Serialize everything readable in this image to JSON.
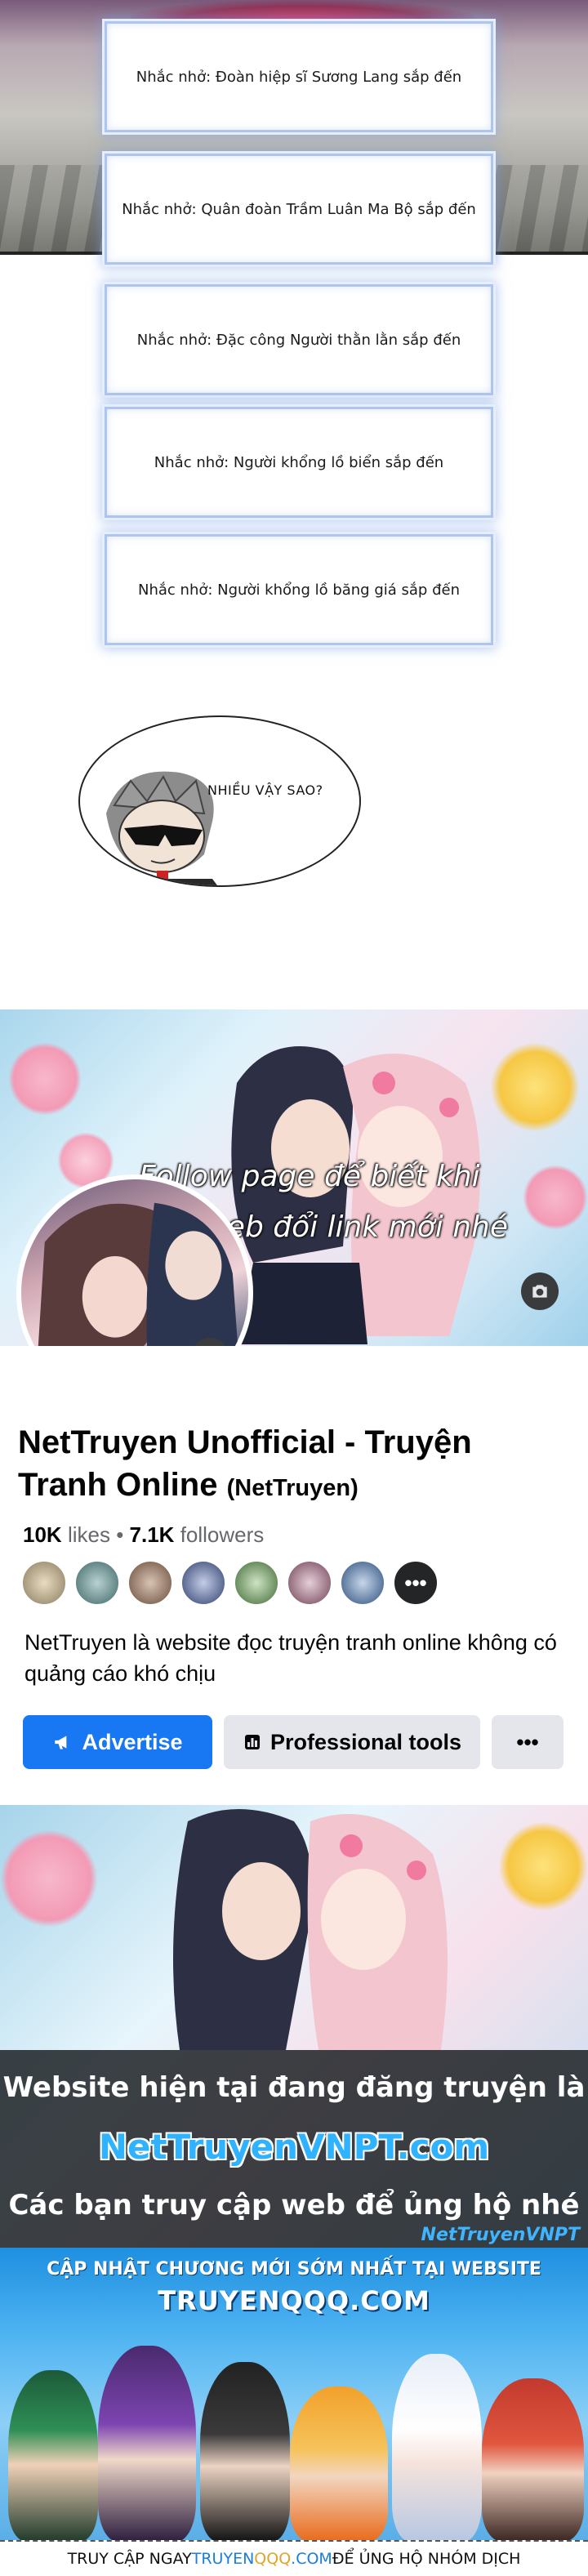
{
  "notices": [
    "Nhắc nhở: Đoàn hiệp sĩ Sương Lang sắp đến",
    "Nhắc nhở: Quân đoàn Trầm Luân Ma Bộ sắp đến",
    "Nhắc nhở: Đặc công Người thằn lằn sắp đến",
    "Nhắc nhở: Người khổng lồ biển sắp đến",
    "Nhắc nhở: Người khổng lồ băng giá sắp đến"
  ],
  "bubble_text": "NHIỀU VẬY SAO?",
  "facebook": {
    "cover_caption_line1": "Follow page để biết khi",
    "cover_caption_line2": "nào web đổi link mới nhé",
    "page_name": "NetTruyen Unofficial - Truyện Tranh Online",
    "page_handle": "(NetTruyen)",
    "likes_count": "10K",
    "likes_label": "likes",
    "separator": "•",
    "followers_count": "7.1K",
    "followers_label": "followers",
    "more_avatars": "•••",
    "bio": "NetTruyen là website đọc truyện tranh online không có quảng cáo khó chịu",
    "advertise_label": "Advertise",
    "professional_tools_label": "Professional tools",
    "more_label": "•••",
    "accent_color": "#1877f2"
  },
  "banner": {
    "line1": "Website hiện tại đang đăng truyện là",
    "line2": "NetTruyenVNPT.com",
    "line3": "Các bạn truy cập web để ủng hộ nhé",
    "watermark": "NetTruyenVNPT"
  },
  "truyenqqq": {
    "line1": "CẬP NHẬT CHƯƠNG MỚI SỚM NHẤT TẠI WEBSITE",
    "line2": "TRUYENQQQ.COM"
  },
  "footer": {
    "prefix": "TRUY CẬP NGAY ",
    "brand_part1": "TRUYEN",
    "brand_part2": "QQQ",
    "brand_part3": ".COM",
    "suffix": " ĐỂ ỦNG HỘ NHÓM DỊCH"
  }
}
